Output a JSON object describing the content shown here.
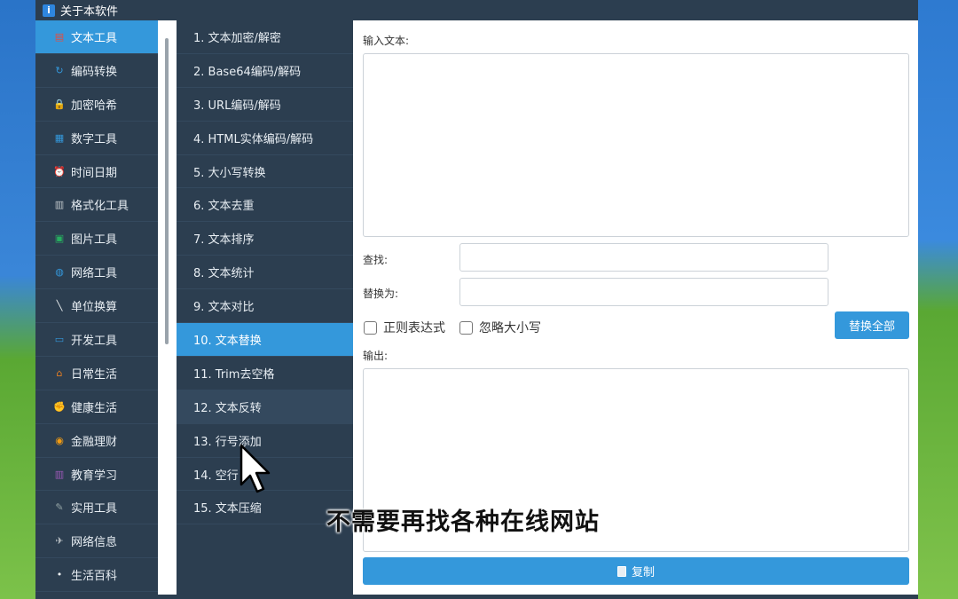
{
  "window": {
    "title": "关于本软件",
    "title_icon": "info-icon"
  },
  "categories": [
    {
      "label": "文本工具",
      "icon": "document-icon",
      "color": "#e74c3c",
      "active": true
    },
    {
      "label": "编码转换",
      "icon": "refresh-icon",
      "color": "#3498db"
    },
    {
      "label": "加密哈希",
      "icon": "lock-icon",
      "color": "#f1c40f"
    },
    {
      "label": "数字工具",
      "icon": "calculator-icon",
      "color": "#3498db"
    },
    {
      "label": "时间日期",
      "icon": "alarm-clock-icon",
      "color": "#e74c3c"
    },
    {
      "label": "格式化工具",
      "icon": "clipboard-icon",
      "color": "#bdc3c7"
    },
    {
      "label": "图片工具",
      "icon": "image-icon",
      "color": "#27ae60"
    },
    {
      "label": "网络工具",
      "icon": "globe-icon",
      "color": "#3498db"
    },
    {
      "label": "单位换算",
      "icon": "ruler-icon",
      "color": "#ecf0f1"
    },
    {
      "label": "开发工具",
      "icon": "laptop-icon",
      "color": "#3498db"
    },
    {
      "label": "日常生活",
      "icon": "home-icon",
      "color": "#e67e22"
    },
    {
      "label": "健康生活",
      "icon": "muscle-icon",
      "color": "#f1c40f"
    },
    {
      "label": "金融理财",
      "icon": "money-bag-icon",
      "color": "#f39c12"
    },
    {
      "label": "教育学习",
      "icon": "books-icon",
      "color": "#9b59b6"
    },
    {
      "label": "实用工具",
      "icon": "tools-icon",
      "color": "#95a5a6"
    },
    {
      "label": "网络信息",
      "icon": "satellite-icon",
      "color": "#bdc3c7"
    },
    {
      "label": "生活百科",
      "icon": "dot-icon",
      "color": "#ecf0f1"
    }
  ],
  "tools": [
    {
      "label": "1. 文本加密/解密"
    },
    {
      "label": "2. Base64编码/解码"
    },
    {
      "label": "3. URL编码/解码"
    },
    {
      "label": "4. HTML实体编码/解码"
    },
    {
      "label": "5. 大小写转换"
    },
    {
      "label": "6. 文本去重"
    },
    {
      "label": "7. 文本排序"
    },
    {
      "label": "8. 文本统计"
    },
    {
      "label": "9. 文本对比"
    },
    {
      "label": "10. 文本替换",
      "active": true
    },
    {
      "label": "11. Trim去空格"
    },
    {
      "label": "12. 文本反转",
      "hover": true
    },
    {
      "label": "13. 行号添加"
    },
    {
      "label": "14. 空行"
    },
    {
      "label": "15. 文本压缩"
    }
  ],
  "panel": {
    "input_label": "输入文本:",
    "input_value": "",
    "find_label": "查找:",
    "find_value": "",
    "replace_label": "替换为:",
    "replace_value": "",
    "regex_label": "正则表达式",
    "ignore_case_label": "忽略大小写",
    "replace_all_label": "替换全部",
    "output_label": "输出:",
    "output_value": "",
    "copy_label": "复制",
    "copy_icon": "clipboard-icon"
  },
  "overlay": {
    "subtitle": "不需要再找各种在线网站"
  }
}
